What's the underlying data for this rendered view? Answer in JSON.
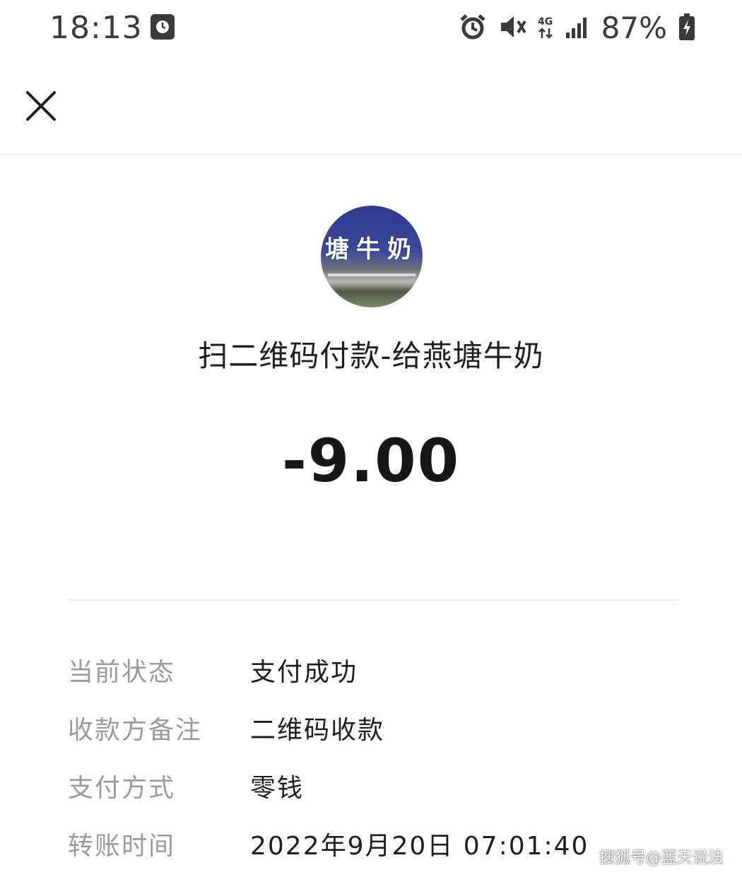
{
  "status_bar": {
    "time": "18:13",
    "battery": "87%",
    "network": "4G",
    "icons": [
      "clock-icon",
      "alarm-icon",
      "mute-icon",
      "signal-icon",
      "battery-charging-icon"
    ]
  },
  "nav": {
    "close_icon": "close-icon"
  },
  "merchant": {
    "avatar_text": "塘牛奶",
    "title": "扫二维码付款-给燕塘牛奶"
  },
  "amount": "-9.00",
  "details": [
    {
      "label": "当前状态",
      "value": "支付成功"
    },
    {
      "label": "收款方备注",
      "value": "二维码收款"
    },
    {
      "label": "支付方式",
      "value": "零钱"
    },
    {
      "label": "转账时间",
      "value": "2022年9月20日 07:01:40"
    }
  ],
  "watermark": "搜狐号@蓝天说法"
}
